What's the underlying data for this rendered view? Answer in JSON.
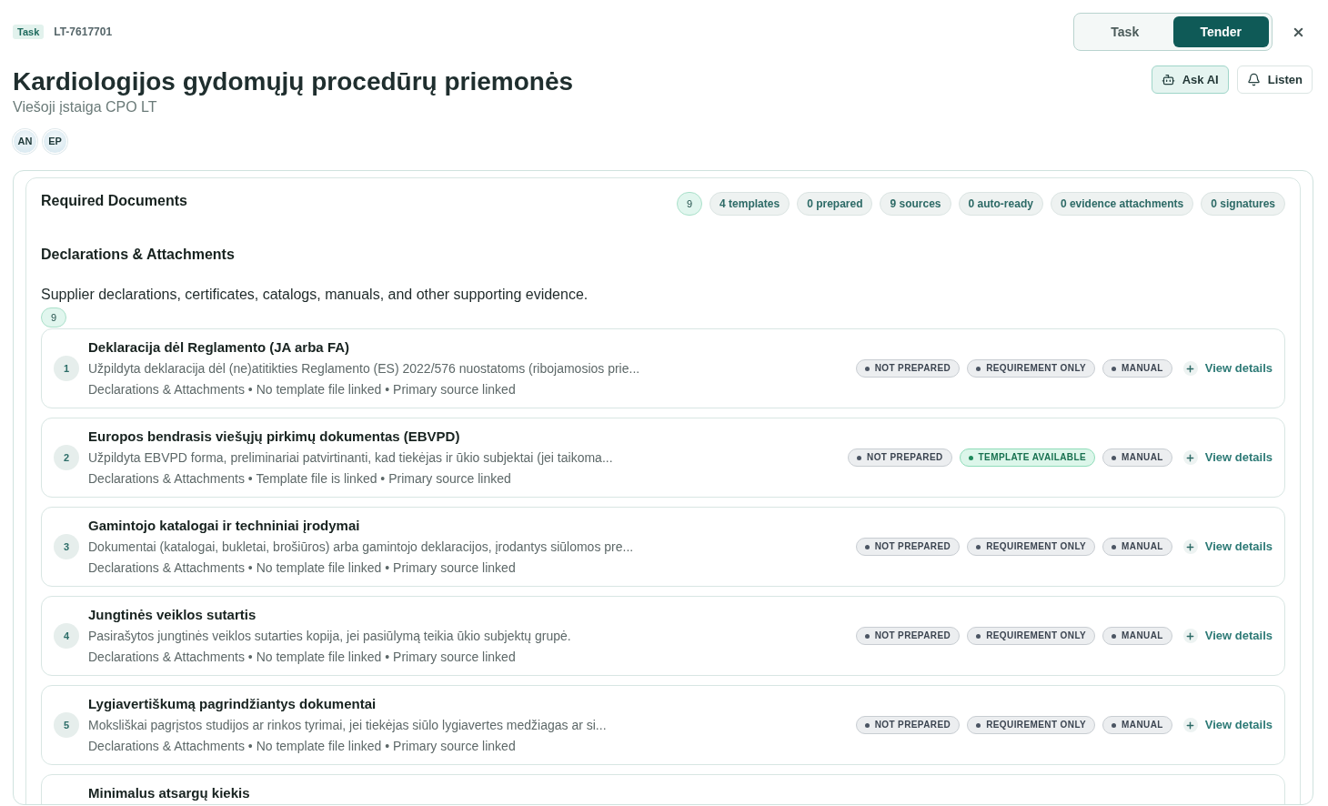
{
  "header": {
    "badge": "Task",
    "reference": "LT-7617701",
    "title": "Kardiologijos gydomųjų procedūrų priemonės",
    "subtitle": "Viešoji įstaiga CPO LT",
    "avatars": [
      {
        "initials": "AN"
      },
      {
        "initials": "EP"
      }
    ]
  },
  "mode_toggle": [
    {
      "label": "Task",
      "selected": false
    },
    {
      "label": "Tender",
      "selected": true
    }
  ],
  "actions": [
    {
      "kind": "ask_ai",
      "label": "Ask AI"
    },
    {
      "kind": "listen",
      "label": "Listen"
    }
  ],
  "required_documents": {
    "title": "Required Documents",
    "summary": [
      {
        "kind": "count",
        "label": "9"
      },
      {
        "kind": "stat",
        "label": "4 templates"
      },
      {
        "kind": "stat",
        "label": "0 prepared"
      },
      {
        "kind": "stat",
        "label": "9 sources"
      },
      {
        "kind": "stat",
        "label": "0 auto-ready"
      },
      {
        "kind": "stat",
        "label": "0 evidence attachments"
      },
      {
        "kind": "stat",
        "label": "0 signatures"
      }
    ]
  },
  "section": {
    "title": "Declarations & Attachments",
    "description": "Supplier declarations, certificates, catalogs, manuals, and other supporting evidence.",
    "count": "9",
    "items": [
      {
        "number": "1",
        "title": "Deklaracija dėl Reglamento (JA arba FA)",
        "description": "Užpildyta deklaracija dėl (ne)atitikties Reglamento (ES) 2022/576 nuostatoms (ribojamosios prie...",
        "meta": "Declarations & Attachments • No template file linked • Primary source linked",
        "tags": [
          {
            "kind": "neutral",
            "label": "NOT PREPARED"
          },
          {
            "kind": "neutral",
            "label": "REQUIREMENT ONLY"
          },
          {
            "kind": "neutral",
            "label": "MANUAL"
          }
        ],
        "action": "View details"
      },
      {
        "number": "2",
        "title": "Europos bendrasis viešųjų pirkimų dokumentas (EBVPD)",
        "description": "Užpildyta EBVPD forma, preliminariai patvirtinanti, kad tiekėjas ir ūkio subjektai (jei taikoma...",
        "meta": "Declarations & Attachments • Template file is linked • Primary source linked",
        "tags": [
          {
            "kind": "neutral",
            "label": "NOT PREPARED"
          },
          {
            "kind": "available",
            "label": "TEMPLATE AVAILABLE"
          },
          {
            "kind": "neutral",
            "label": "MANUAL"
          }
        ],
        "action": "View details"
      },
      {
        "number": "3",
        "title": "Gamintojo katalogai ir techniniai įrodymai",
        "description": "Dokumentai (katalogai, bukletai, brošiūros) arba gamintojo deklaracijos, įrodantys siūlomos pre...",
        "meta": "Declarations & Attachments • No template file linked • Primary source linked",
        "tags": [
          {
            "kind": "neutral",
            "label": "NOT PREPARED"
          },
          {
            "kind": "neutral",
            "label": "REQUIREMENT ONLY"
          },
          {
            "kind": "neutral",
            "label": "MANUAL"
          }
        ],
        "action": "View details"
      },
      {
        "number": "4",
        "title": "Jungtinės veiklos sutartis",
        "description": "Pasirašytos jungtinės veiklos sutarties kopija, jei pasiūlymą teikia ūkio subjektų grupė.",
        "meta": "Declarations & Attachments • No template file linked • Primary source linked",
        "tags": [
          {
            "kind": "neutral",
            "label": "NOT PREPARED"
          },
          {
            "kind": "neutral",
            "label": "REQUIREMENT ONLY"
          },
          {
            "kind": "neutral",
            "label": "MANUAL"
          }
        ],
        "action": "View details"
      },
      {
        "number": "5",
        "title": "Lygiavertiškumą pagrindžiantys dokumentai",
        "description": "Moksliškai pagrįstos studijos ar rinkos tyrimai, jei tiekėjas siūlo lygiavertes medžiagas ar si...",
        "meta": "Declarations & Attachments • No template file linked • Primary source linked",
        "tags": [
          {
            "kind": "neutral",
            "label": "NOT PREPARED"
          },
          {
            "kind": "neutral",
            "label": "REQUIREMENT ONLY"
          },
          {
            "kind": "neutral",
            "label": "MANUAL"
          }
        ],
        "action": "View details"
      },
      {
        "title": "Minimalus atsargų kiekis"
      }
    ]
  }
}
